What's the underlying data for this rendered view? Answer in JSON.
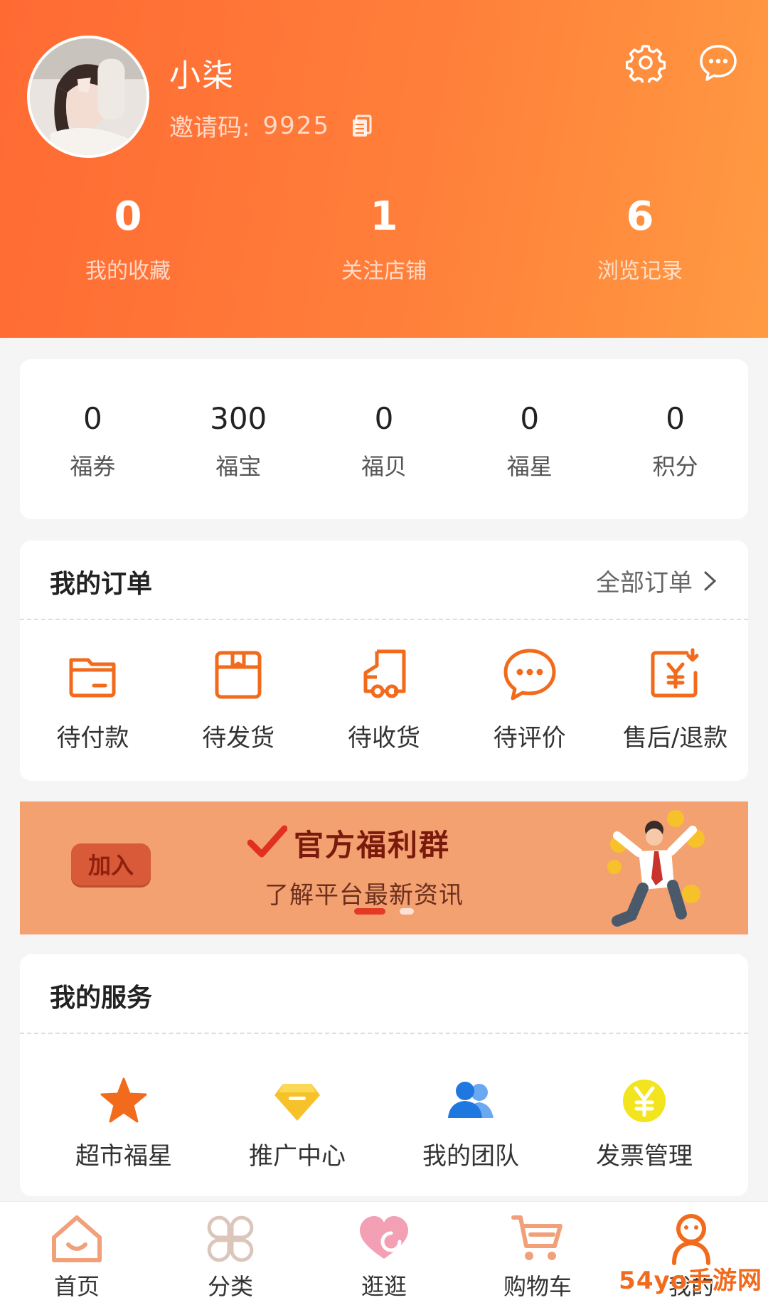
{
  "profile": {
    "nickname": "小柒",
    "invite_label": "邀请码:",
    "invite_code": "9925"
  },
  "header_stats": [
    {
      "value": "0",
      "label": "我的收藏"
    },
    {
      "value": "1",
      "label": "关注店铺"
    },
    {
      "value": "6",
      "label": "浏览记录"
    }
  ],
  "assets": [
    {
      "value": "0",
      "label": "福券"
    },
    {
      "value": "300",
      "label": "福宝"
    },
    {
      "value": "0",
      "label": "福贝"
    },
    {
      "value": "0",
      "label": "福星"
    },
    {
      "value": "0",
      "label": "积分"
    }
  ],
  "orders": {
    "title": "我的订单",
    "all_label": "全部订单",
    "items": [
      {
        "label": "待付款",
        "icon": "wallet-icon"
      },
      {
        "label": "待发货",
        "icon": "package-icon"
      },
      {
        "label": "待收货",
        "icon": "truck-icon"
      },
      {
        "label": "待评价",
        "icon": "comment-icon"
      },
      {
        "label": "售后/退款",
        "icon": "refund-icon"
      }
    ]
  },
  "banner": {
    "join_label": "加入",
    "title": "官方福利群",
    "subtitle": "了解平台最新资讯"
  },
  "services": {
    "title": "我的服务",
    "items": [
      {
        "label": "超市福星",
        "icon": "star-icon"
      },
      {
        "label": "推广中心",
        "icon": "gem-icon"
      },
      {
        "label": "我的团队",
        "icon": "team-icon"
      },
      {
        "label": "发票管理",
        "icon": "yen-icon"
      }
    ]
  },
  "tabbar": [
    {
      "label": "首页",
      "icon": "home-icon"
    },
    {
      "label": "分类",
      "icon": "category-icon"
    },
    {
      "label": "逛逛",
      "icon": "heart-icon"
    },
    {
      "label": "购物车",
      "icon": "cart-icon"
    },
    {
      "label": "我的",
      "icon": "user-icon"
    }
  ],
  "watermark": "54yo手游网",
  "colors": {
    "brand_orange": "#ff6a33",
    "banner_bg": "#f4a172",
    "icon_orange": "#f26a1b"
  }
}
